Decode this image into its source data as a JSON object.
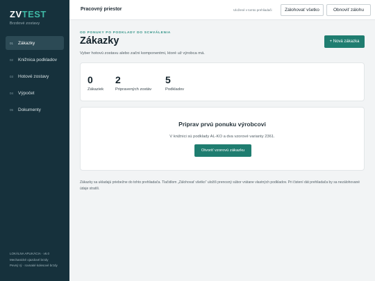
{
  "sidebar": {
    "logo_main": "ZV",
    "logo_accent": "TEST",
    "subtitle": "Brzdové zostavy",
    "items": [
      {
        "num": "01",
        "label": "Zákazky",
        "active": true
      },
      {
        "num": "02",
        "label": "Knižnica podkladov",
        "active": false
      },
      {
        "num": "03",
        "label": "Hotové zostavy",
        "active": false
      },
      {
        "num": "04",
        "label": "Výpočet",
        "active": false
      },
      {
        "num": "05",
        "label": "Dokumenty",
        "active": false
      }
    ],
    "footer": {
      "line1": "LOKÁLNA APLIKÁCIA · v6.0",
      "line2": "Mechanické ojazdové brzdy",
      "line3": "Pevný rý · rovnaké kolesové brzdy"
    }
  },
  "topbar": {
    "title": "Pracovný priestor",
    "hint": "Uložené v tomto prehliadači",
    "save_label": "Zálohovať všetko",
    "restore_label": "Obnoviť zálohu"
  },
  "main": {
    "eyebrow": "OD PONUKY PO PODKLADY DO SCHVÁLENIA",
    "title": "Zákazky",
    "subtitle": "Vyber hotovú zostavu alebo začni komponentmi, ktoré už výrobca má.",
    "new_button": "+ Nová zákazka",
    "stats": [
      {
        "value": "0",
        "label": "Zákaziek"
      },
      {
        "value": "2",
        "label": "Pripravených zostáv"
      },
      {
        "value": "5",
        "label": "Podkladov"
      }
    ],
    "empty": {
      "title": "Priprav prvú ponuku výrobcovi",
      "text": "V knižnici sú podklady AL-KO a dva vzorové varianty 2361.",
      "button": "Otvoriť vzorovú zákazku"
    },
    "footnote": "Zákazky sa ukladajú priebežne do tohto prehliadača. Tlačidlom „Zálohovať všetko“ uložíš prenosný súbor vrátane vlastných podkladov. Pri čistení dát prehliadača by sa nezálohované údaje stratili."
  }
}
